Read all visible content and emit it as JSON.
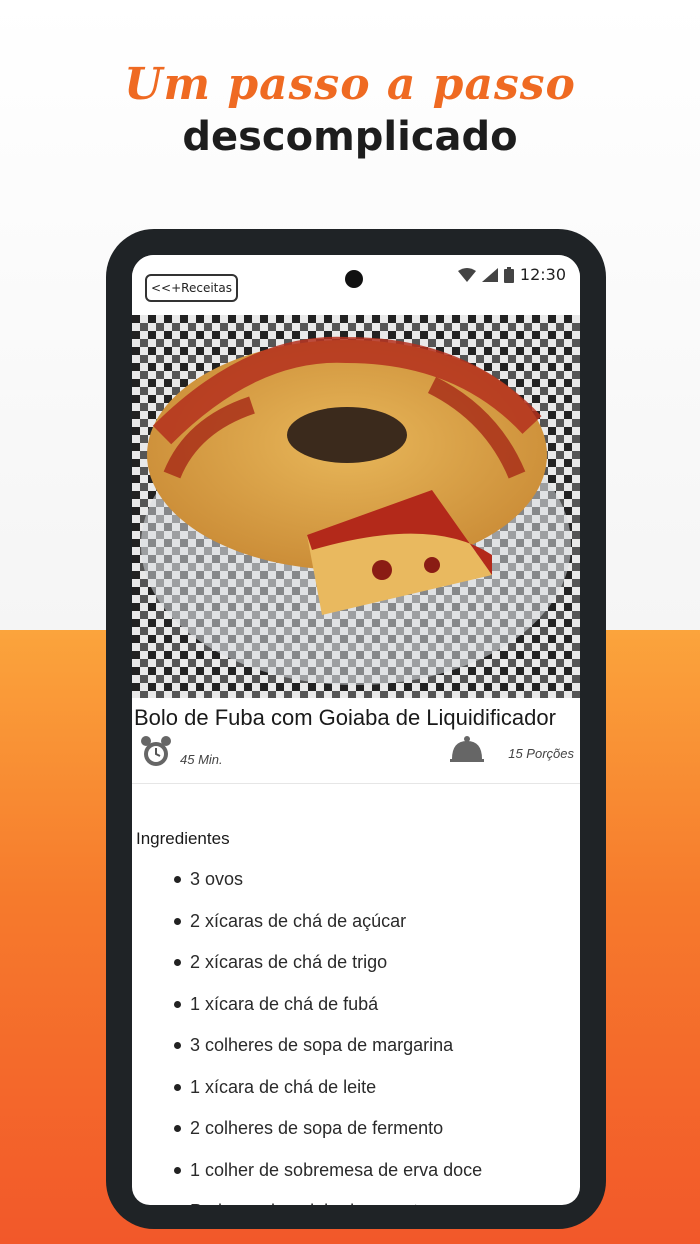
{
  "promo": {
    "line1": "Um passo a passo",
    "line2": "descomplicado"
  },
  "status_bar": {
    "time": "12:30"
  },
  "nav": {
    "back_label": "<<+Receitas"
  },
  "recipe": {
    "title": " Bolo de Fuba com Goiaba de Liquidificador",
    "time": "45 Min.",
    "servings": "15 Porções",
    "ingredients_heading": "Ingredientes",
    "ingredients": [
      "3 ovos",
      "2 xícaras de chá de açúcar",
      "2 xícaras de chá de trigo",
      "1 xícara de chá de fubá",
      "3 colheres de sopa de margarina",
      "1 xícara de chá de leite",
      "2 colheres de sopa de fermento",
      "1 colher de sobremesa de erva doce",
      "Pedaços de goiabada a gosto"
    ]
  },
  "colors": {
    "accent": "#ef6a22",
    "orange_bg": "#f67a2c",
    "phone_frame": "#1f2326"
  }
}
